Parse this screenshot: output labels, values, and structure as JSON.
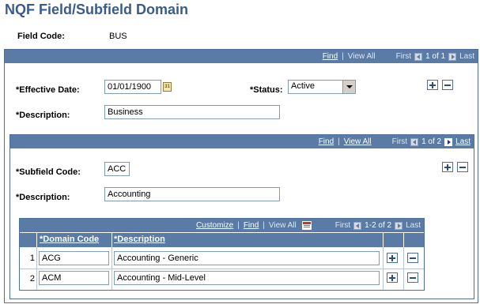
{
  "page": {
    "title": "NQF Field/Subfield Domain"
  },
  "field_code": {
    "label": "Field Code:",
    "value": "BUS"
  },
  "outer_nav": {
    "find": "Find",
    "view_all": "View All",
    "first": "First",
    "counter": "1 of 1",
    "last": "Last"
  },
  "effdt": {
    "label": "*Effective Date:",
    "value": "01/01/1900",
    "calendar_icon_text": "31"
  },
  "status": {
    "label": "*Status:",
    "value": "Active"
  },
  "description1": {
    "label": "*Description:",
    "value": "Business"
  },
  "subfield_nav": {
    "find": "Find",
    "view_all": "View All",
    "first": "First",
    "counter": "1 of 2",
    "last": "Last"
  },
  "subfield": {
    "label": "*Subfield Code:",
    "value": "ACC"
  },
  "description2": {
    "label": "*Description:",
    "value": "Accounting"
  },
  "grid_nav": {
    "customize": "Customize",
    "find": "Find",
    "view_all": "View All",
    "first": "First",
    "counter": "1-2 of 2",
    "last": "Last"
  },
  "grid": {
    "columns": [
      "*Domain Code",
      "*Description"
    ],
    "rows": [
      {
        "num": "1",
        "code": "ACG",
        "description": "Accounting - Generic"
      },
      {
        "num": "2",
        "code": "ACM",
        "description": "Accounting - Mid-Level"
      }
    ]
  },
  "colors": {
    "header_blue": "#5a7ba6",
    "title_blue": "#3b5b89",
    "border_blue": "#4e6e9c"
  }
}
